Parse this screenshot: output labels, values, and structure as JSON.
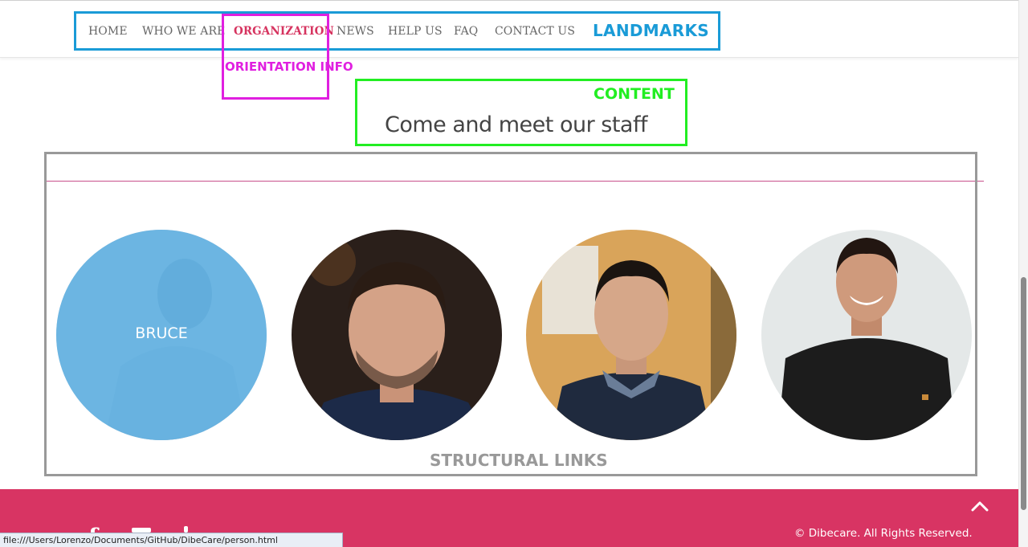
{
  "nav": {
    "items": [
      {
        "label": "HOME"
      },
      {
        "label": "WHO WE ARE"
      },
      {
        "label": "ORGANIZATION"
      },
      {
        "label": "NEWS"
      },
      {
        "label": "HELP US"
      },
      {
        "label": "FAQ"
      },
      {
        "label": "CONTACT US"
      }
    ],
    "active": "ORGANIZATION"
  },
  "annotations": {
    "landmarks": "LANDMARKS",
    "orientation": "ORIENTATION INFO",
    "content": "CONTENT",
    "structural": "STRUCTURAL LINKS"
  },
  "main": {
    "heading": "Come and meet our staff",
    "staff": [
      {
        "name": "BRUCE"
      }
    ]
  },
  "footer": {
    "copyright": "© Dibecare. All Rights Reserved."
  },
  "status_bar": {
    "url": "file:///Users/Lorenzo/Documents/GitHub/DibeCare/person.html"
  },
  "colors": {
    "accent": "#d83463",
    "landmarks": "#1a9bd7",
    "orientation": "#e020e0",
    "content": "#22ee22",
    "structural": "#999999",
    "overlay": "#5eb0e2"
  }
}
